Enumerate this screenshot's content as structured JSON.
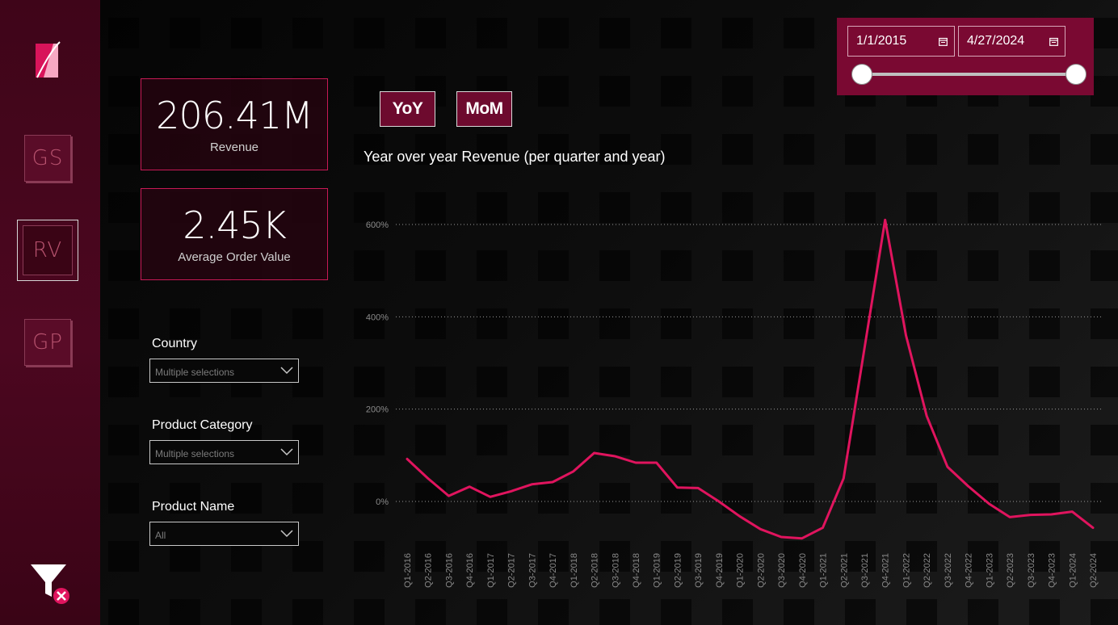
{
  "colors": {
    "accent": "#e0145e",
    "sidebar": "#4c0720",
    "panel": "#7a0932"
  },
  "sidebar": {
    "logo_icon": "brand-logo-icon",
    "nav": [
      {
        "label": "GS",
        "active": false
      },
      {
        "label": "RV",
        "active": true
      },
      {
        "label": "GP",
        "active": false
      }
    ],
    "clear_filters_icon": "filter-clear-icon"
  },
  "kpis": [
    {
      "value": "206.41M",
      "label": "Revenue"
    },
    {
      "value": "2.45K",
      "label": "Average Order Value"
    }
  ],
  "filters": [
    {
      "label": "Country",
      "value": "Multiple selections"
    },
    {
      "label": "Product Category",
      "value": "Multiple selections"
    },
    {
      "label": "Product Name",
      "value": "All"
    }
  ],
  "toggles": {
    "yoy": "YoY",
    "mom": "MoM"
  },
  "date_range": {
    "start": "1/1/2015",
    "end": "4/27/2024",
    "calendar_icon": "calendar-icon"
  },
  "chart_data": {
    "type": "line",
    "title": "Year over year Revenue (per quarter and year)",
    "y_ticks": [
      "0%",
      "200%",
      "400%",
      "600%"
    ],
    "ylim": [
      -100,
      650
    ],
    "grid": "horizontal-dotted",
    "x": [
      "Q1-2016",
      "Q2-2016",
      "Q3-2016",
      "Q4-2016",
      "Q1-2017",
      "Q2-2017",
      "Q3-2017",
      "Q4-2017",
      "Q1-2018",
      "Q2-2018",
      "Q3-2018",
      "Q4-2018",
      "Q1-2019",
      "Q2-2019",
      "Q3-2019",
      "Q4-2019",
      "Q1-2020",
      "Q2-2020",
      "Q3-2020",
      "Q4-2020",
      "Q1-2021",
      "Q2-2021",
      "Q3-2021",
      "Q4-2021",
      "Q1-2022",
      "Q2-2022",
      "Q3-2022",
      "Q4-2022",
      "Q1-2023",
      "Q2-2023",
      "Q3-2023",
      "Q4-2023",
      "Q1-2024",
      "Q2-2024"
    ],
    "series": [
      {
        "values": [
          92,
          50,
          12,
          32,
          10,
          22,
          37,
          42,
          65,
          105,
          98,
          84,
          84,
          30,
          29,
          0,
          -32,
          -60,
          -77,
          -80,
          -57,
          50,
          330,
          610,
          360,
          185,
          75,
          33,
          -5,
          -34,
          -29,
          -28,
          -22,
          -57
        ]
      }
    ]
  }
}
